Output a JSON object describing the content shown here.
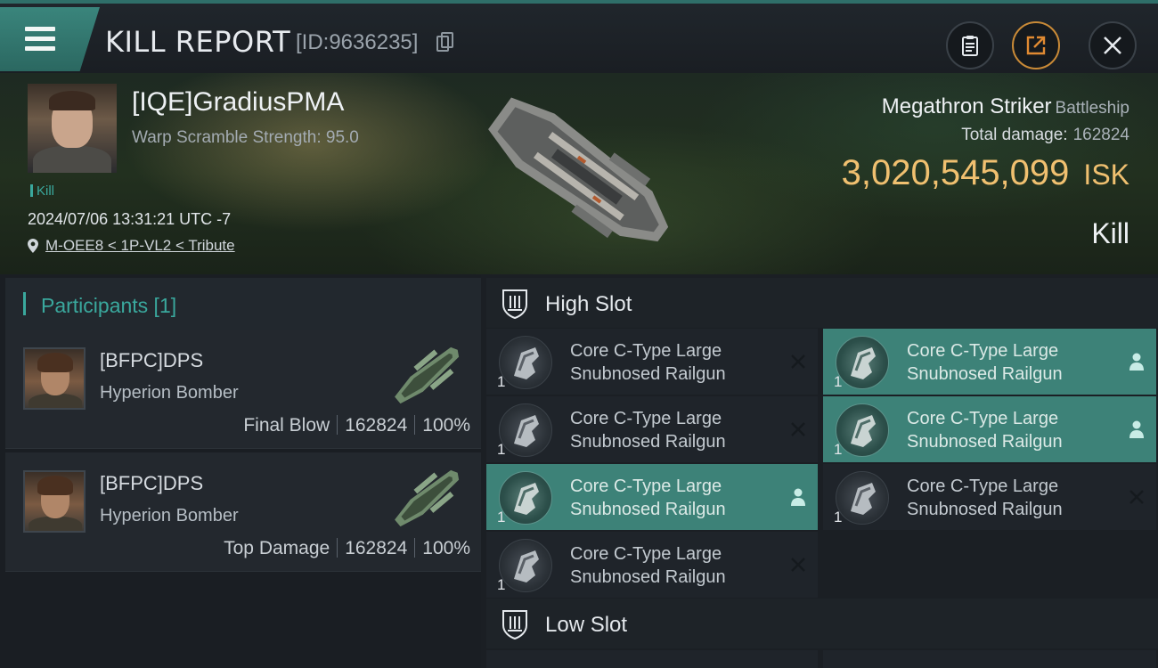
{
  "header": {
    "title": "KILL REPORT",
    "report_id": "[ID:9636235]"
  },
  "victim": {
    "name": "[IQE]GradiusPMA",
    "subtitle": "Warp Scramble Strength: 95.0",
    "tag": "Kill",
    "datetime": "2024/07/06 13:31:21 UTC -7",
    "location": "M-OEE8 < 1P-VL2 < Tribute"
  },
  "ship": {
    "name": "Megathron Striker",
    "class": "Battleship",
    "total_damage_label": "Total damage:",
    "total_damage": "162824",
    "value": "3,020,545,099",
    "currency": "ISK",
    "outcome": "Kill"
  },
  "participants": {
    "title": "Participants [1]",
    "rows": [
      {
        "name": "[BFPC]DPS",
        "ship": "Hyperion Bomber",
        "role": "Final Blow",
        "damage": "162824",
        "percent": "100%"
      },
      {
        "name": "[BFPC]DPS",
        "ship": "Hyperion Bomber",
        "role": "Top Damage",
        "damage": "162824",
        "percent": "100%"
      }
    ]
  },
  "high_slot": {
    "label": "High Slot",
    "items": [
      {
        "line1": "Core C-Type Large",
        "line2": "Snubnosed Railgun",
        "qty": "1",
        "status": "destroyed"
      },
      {
        "line1": "Core C-Type Large",
        "line2": "Snubnosed Railgun",
        "qty": "1",
        "status": "dropped"
      },
      {
        "line1": "Core C-Type Large",
        "line2": "Snubnosed Railgun",
        "qty": "1",
        "status": "destroyed"
      },
      {
        "line1": "Core C-Type Large",
        "line2": "Snubnosed Railgun",
        "qty": "1",
        "status": "dropped"
      },
      {
        "line1": "Core C-Type Large",
        "line2": "Snubnosed Railgun",
        "qty": "1",
        "status": "dropped"
      },
      {
        "line1": "Core C-Type Large",
        "line2": "Snubnosed Railgun",
        "qty": "1",
        "status": "destroyed"
      },
      {
        "line1": "Core C-Type Large",
        "line2": "Snubnosed Railgun",
        "qty": "1",
        "status": "destroyed"
      }
    ]
  },
  "low_slot": {
    "label": "Low Slot"
  },
  "colors": {
    "accent": "#3aa89d",
    "highlight": "#3d8278",
    "isk": "#f0c070"
  },
  "icons": [
    "menu-icon",
    "copy-icon",
    "clipboard-icon",
    "share-icon",
    "close-icon",
    "location-pin-icon",
    "shield-slot-icon",
    "railgun-icon",
    "close-x-icon",
    "person-icon"
  ]
}
